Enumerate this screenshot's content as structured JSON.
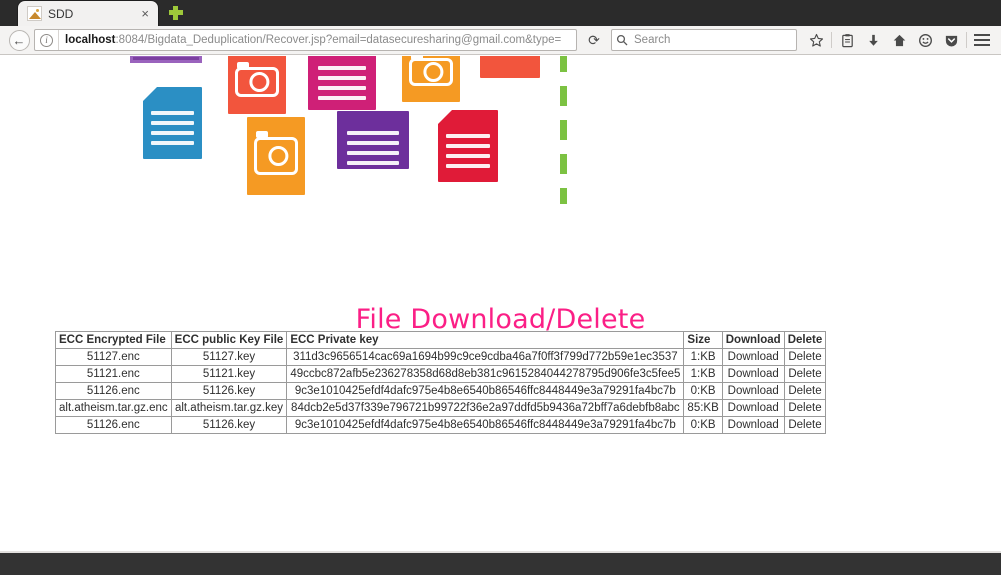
{
  "browser": {
    "tab": {
      "title": "SDD",
      "favicon": "broken-image-icon",
      "close_label": "×"
    },
    "new_tab_label": "+",
    "nav": {
      "back_label": "←",
      "identity_label": "i",
      "url_host": "localhost",
      "url_rest": ":8084/Bigdata_Deduplication/Recover.jsp?email=datasecuresharing@gmail.com&type=",
      "reload_label": "⟳"
    },
    "search": {
      "placeholder": "Search",
      "value": ""
    },
    "toolbar_icons": [
      {
        "name": "bookmark-star-icon",
        "glyph": "☆"
      },
      {
        "name": "library-icon",
        "glyph": "Ὄb"
      },
      {
        "name": "downloads-icon",
        "glyph": "↓"
      },
      {
        "name": "home-icon",
        "glyph": "⌂"
      },
      {
        "name": "sync-smiley-icon",
        "glyph": "☺"
      },
      {
        "name": "pocket-shield-icon",
        "glyph": "▼"
      }
    ],
    "menu_label": "☰"
  },
  "page": {
    "title": "File Download/Delete",
    "title_color": "#fb1f86",
    "accent_green": "#7cc242",
    "banner": {
      "tiles": [
        {
          "name": "document-tile-purple-cut",
          "color": "#7b3fa0"
        },
        {
          "name": "camera-tile-red",
          "color": "#f2553d"
        },
        {
          "name": "document-tile-magenta",
          "color": "#cf2077"
        },
        {
          "name": "camera-tile-orange",
          "color": "#f59a23"
        },
        {
          "name": "block-tile-red",
          "color": "#f2553d"
        },
        {
          "name": "document-tile-blue",
          "color": "#2b8fc4"
        },
        {
          "name": "camera-tile-orange-2",
          "color": "#f59a23"
        },
        {
          "name": "document-tile-violet",
          "color": "#6d2f9c"
        },
        {
          "name": "document-tile-crimson",
          "color": "#e01b38"
        }
      ]
    },
    "table": {
      "headers": [
        "ECC Encrypted File",
        "ECC public Key File",
        "ECC Private key",
        "Size",
        "Download",
        "Delete"
      ],
      "rows": [
        {
          "encrypted_file": "51127.enc",
          "public_key_file": "51127.key",
          "private_key": "311d3c9656514cac69a1694b99c9ce9cdba46a7f0ff3f799d772b59e1ec3537",
          "size": "1:KB",
          "download": "Download",
          "delete": "Delete"
        },
        {
          "encrypted_file": "51121.enc",
          "public_key_file": "51121.key",
          "private_key": "49ccbc872afb5e236278358d68d8eb381c9615284044278795d906fe3c5fee5",
          "size": "1:KB",
          "download": "Download",
          "delete": "Delete"
        },
        {
          "encrypted_file": "51126.enc",
          "public_key_file": "51126.key",
          "private_key": "9c3e1010425efdf4dafc975e4b8e6540b86546ffc8448449e3a79291fa4bc7b",
          "size": "0:KB",
          "download": "Download",
          "delete": "Delete"
        },
        {
          "encrypted_file": "alt.atheism.tar.gz.enc",
          "public_key_file": "alt.atheism.tar.gz.key",
          "private_key": "84dcb2e5d37f339e796721b99722f36e2a97ddfd5b9436a72bff7a6debfb8abc",
          "size": "85:KB",
          "download": "Download",
          "delete": "Delete"
        },
        {
          "encrypted_file": "51126.enc",
          "public_key_file": "51126.key",
          "private_key": "9c3e1010425efdf4dafc975e4b8e6540b86546ffc8448449e3a79291fa4bc7b",
          "size": "0:KB",
          "download": "Download",
          "delete": "Delete"
        }
      ]
    }
  }
}
